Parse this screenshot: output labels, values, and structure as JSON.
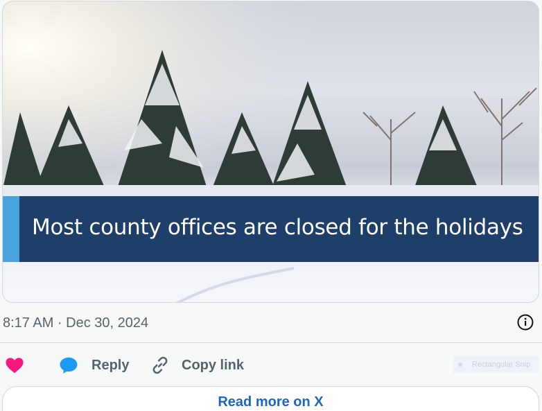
{
  "post": {
    "image_caption": "Most county offices are closed for the holidays",
    "timestamp": "8:17 AM · Dec 30, 2024"
  },
  "actions": {
    "reply_label": "Reply",
    "copy_label": "Copy link"
  },
  "overlay": {
    "snip_label": "Rectangular Snip"
  },
  "footer": {
    "read_more_label": "Read more on X"
  },
  "icons": {
    "like": "heart-icon",
    "reply": "speech-bubble-icon",
    "copy": "link-icon",
    "info": "info-icon"
  },
  "colors": {
    "heart": "#f91880",
    "reply_bubble": "#1d9bf0",
    "banner": "#1f3f6b",
    "banner_accent": "#4aa3dc",
    "link_text": "#1d66c2",
    "muted_text": "#536471"
  }
}
